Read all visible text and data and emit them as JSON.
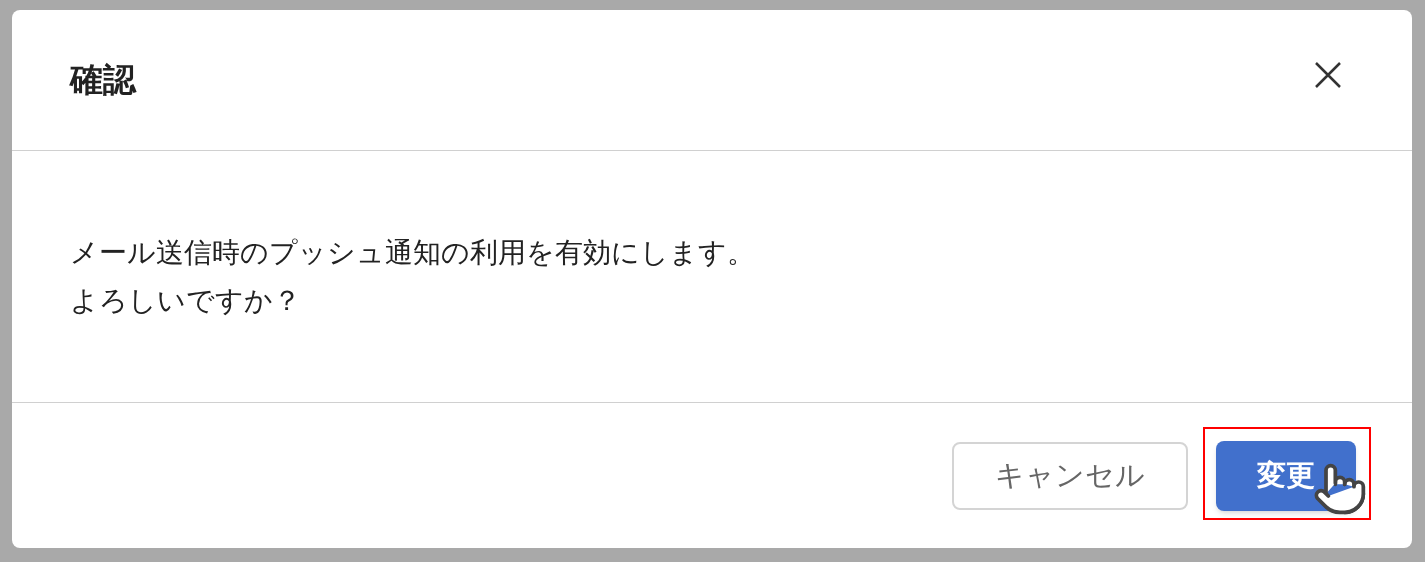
{
  "dialog": {
    "title": "確認",
    "message": [
      "メール送信時のプッシュ通知の利用を有効にします。",
      "よろしいですか？"
    ],
    "buttons": [
      {
        "label": "キャンセル",
        "kind": "secondary",
        "highlighted": false
      },
      {
        "label": "変更",
        "kind": "primary",
        "highlighted": true
      }
    ]
  }
}
